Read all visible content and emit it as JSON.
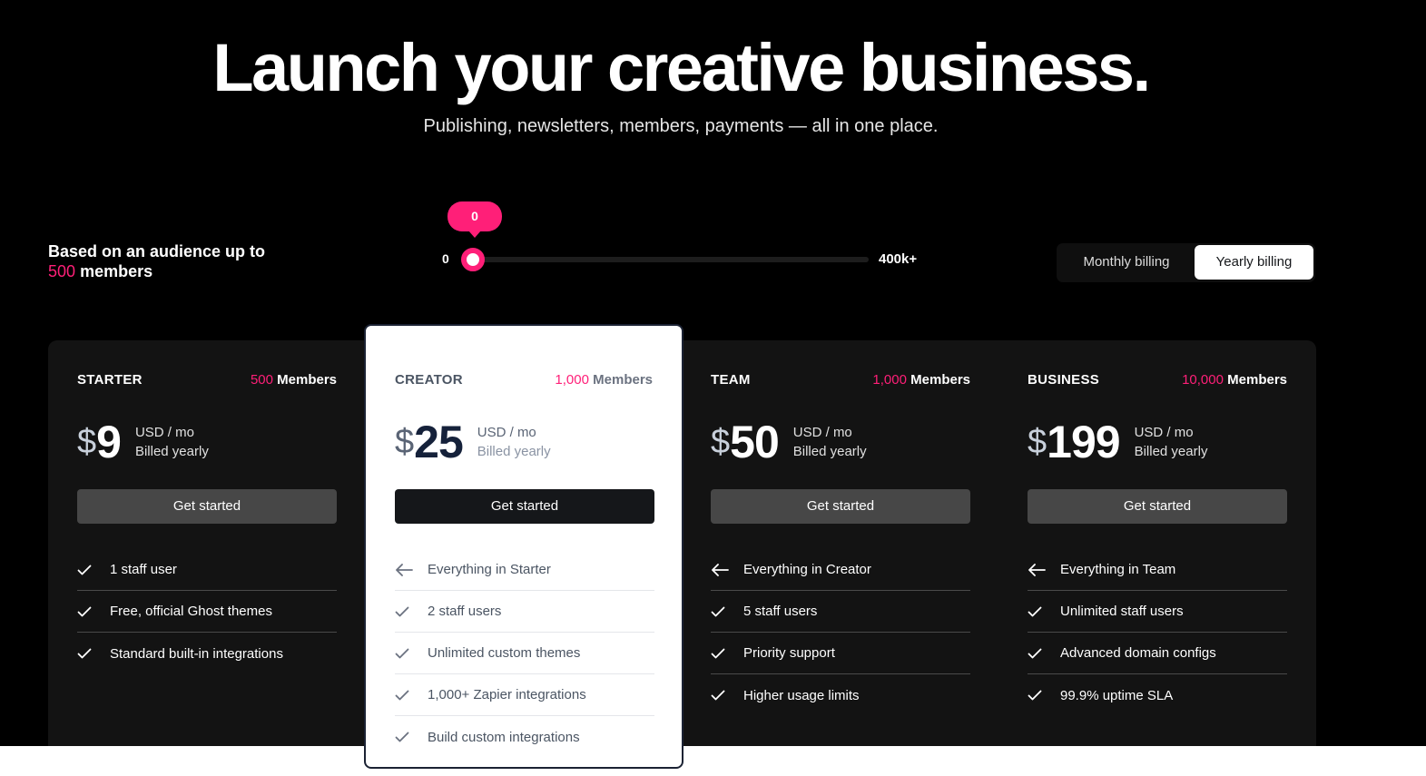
{
  "hero": {
    "title": "Launch your creative business.",
    "subtitle": "Publishing, newsletters, members, payments — all in one place."
  },
  "audience": {
    "line1": "Based on an audience up to",
    "count": "500",
    "unit": "members"
  },
  "slider": {
    "min_label": "0",
    "max_label": "400k+",
    "bubble_value": "0",
    "value_fraction": 0
  },
  "billing": {
    "options": [
      "Monthly billing",
      "Yearly billing"
    ],
    "selected": "Yearly billing"
  },
  "colors": {
    "accent": "#ff1f78",
    "background": "#000000",
    "panel": "#131313"
  },
  "plans": [
    {
      "name": "STARTER",
      "members_count": "500",
      "members_label": "Members",
      "currency_symbol": "$",
      "price": "9",
      "unit": "USD / mo",
      "billing_note": "Billed yearly",
      "cta": "Get started",
      "features": [
        {
          "icon": "check-icon",
          "text": "1 staff user"
        },
        {
          "icon": "check-icon",
          "text": "Free, official Ghost themes"
        },
        {
          "icon": "check-icon",
          "text": "Standard built-in integrations"
        }
      ]
    },
    {
      "name": "CREATOR",
      "members_count": "1,000",
      "members_label": "Members",
      "currency_symbol": "$",
      "price": "25",
      "unit": "USD / mo",
      "billing_note": "Billed yearly",
      "cta": "Get started",
      "highlighted": true,
      "features": [
        {
          "icon": "arrow-left-icon",
          "text": "Everything in Starter"
        },
        {
          "icon": "check-icon",
          "text": "2 staff users"
        },
        {
          "icon": "check-icon",
          "text": "Unlimited custom themes"
        },
        {
          "icon": "check-icon",
          "text": "1,000+ Zapier integrations"
        },
        {
          "icon": "check-icon",
          "text": "Build custom integrations"
        }
      ]
    },
    {
      "name": "TEAM",
      "members_count": "1,000",
      "members_label": "Members",
      "currency_symbol": "$",
      "price": "50",
      "unit": "USD / mo",
      "billing_note": "Billed yearly",
      "cta": "Get started",
      "features": [
        {
          "icon": "arrow-left-icon",
          "text": "Everything in Creator"
        },
        {
          "icon": "check-icon",
          "text": "5 staff users"
        },
        {
          "icon": "check-icon",
          "text": "Priority support"
        },
        {
          "icon": "check-icon",
          "text": "Higher usage limits"
        }
      ]
    },
    {
      "name": "BUSINESS",
      "members_count": "10,000",
      "members_label": "Members",
      "currency_symbol": "$",
      "price": "199",
      "unit": "USD / mo",
      "billing_note": "Billed yearly",
      "cta": "Get started",
      "features": [
        {
          "icon": "arrow-left-icon",
          "text": "Everything in Team"
        },
        {
          "icon": "check-icon",
          "text": "Unlimited staff users"
        },
        {
          "icon": "check-icon",
          "text": "Advanced domain configs"
        },
        {
          "icon": "check-icon",
          "text": "99.9% uptime SLA"
        }
      ]
    }
  ]
}
